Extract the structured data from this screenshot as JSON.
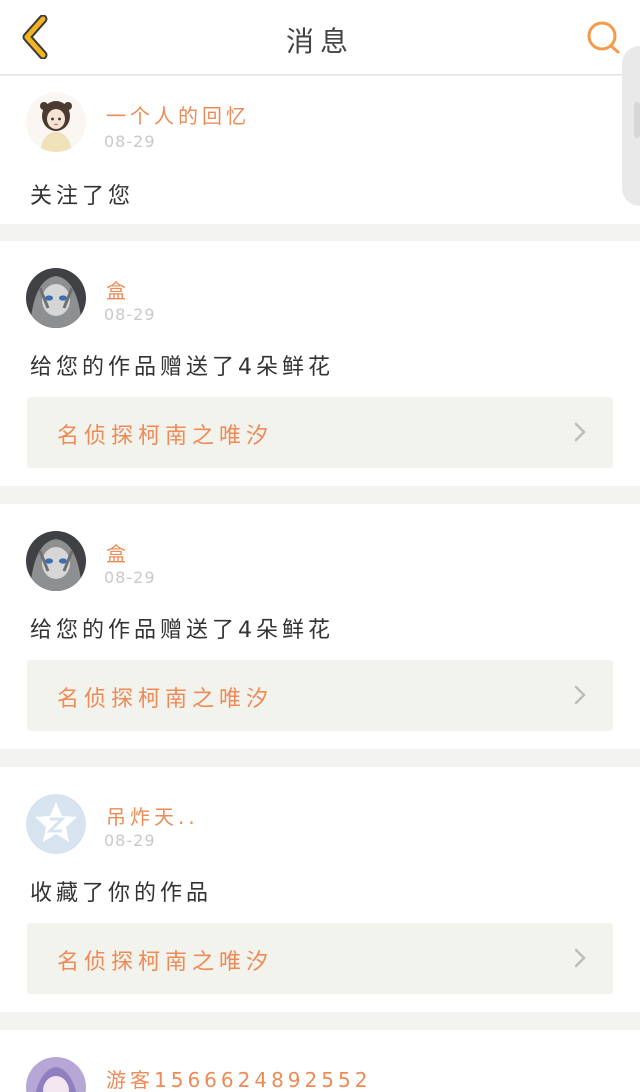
{
  "header": {
    "title": "消息"
  },
  "messages": [
    {
      "name": "一个人的回忆",
      "date": "08-29",
      "text": "关注了您",
      "avatar": "girl-avatar-icon"
    },
    {
      "name": "盒",
      "date": "08-29",
      "text": "给您的作品赠送了4朵鲜花",
      "work": "名侦探柯南之唯汐",
      "avatar": "anime-avatar-icon"
    },
    {
      "name": "盒",
      "date": "08-29",
      "text": "给您的作品赠送了4朵鲜花",
      "work": "名侦探柯南之唯汐",
      "avatar": "anime-avatar-icon"
    },
    {
      "name": "吊炸天..",
      "date": "08-29",
      "text": "收藏了你的作品",
      "work": "名侦探柯南之唯汐",
      "avatar": "default-star-avatar-icon"
    },
    {
      "name": "游客1566624892552",
      "avatar": "anime-avatar-icon"
    }
  ],
  "colors": {
    "accent": "#ee8a55",
    "back_arrow": "#f2b51d",
    "search": "#f29b4a",
    "date": "#c9c9c9",
    "work_bg": "#f3f3ee"
  }
}
